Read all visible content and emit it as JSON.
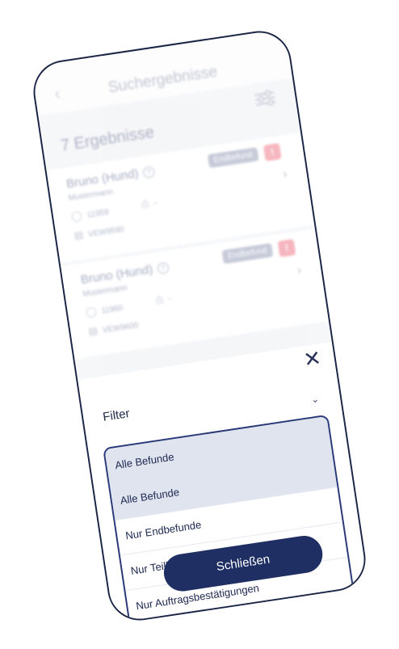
{
  "header": {
    "title": "Suchergebnisse"
  },
  "results": {
    "count_label": "7 Ergebnisse",
    "cards": [
      {
        "name": "Bruno (Hund)",
        "owner": "Mustermann",
        "badge": "Endbefund",
        "alert": "!",
        "patient_id": "11959",
        "printer_value": "-",
        "order_ref": "VEW9590"
      },
      {
        "name": "Bruno (Hund)",
        "owner": "Mustermann",
        "badge": "Endbefund",
        "alert": "!",
        "patient_id": "11960",
        "printer_value": "-",
        "order_ref": "VEW9600"
      }
    ]
  },
  "sheet": {
    "label": "Filter",
    "current_value": "Alle Befunde",
    "options": [
      "Alle Befunde",
      "Nur Endbefunde",
      "Nur Teilbefunde",
      "Nur Auftragsbestätigungen"
    ],
    "close_label": "Schließen"
  },
  "colors": {
    "primary": "#1f2f63",
    "badge_gray": "#9aa2ba",
    "alert_red": "#ef7c8b"
  },
  "icons": {
    "back": "chevron-left-icon",
    "filter": "sliders-icon",
    "close": "close-icon"
  }
}
